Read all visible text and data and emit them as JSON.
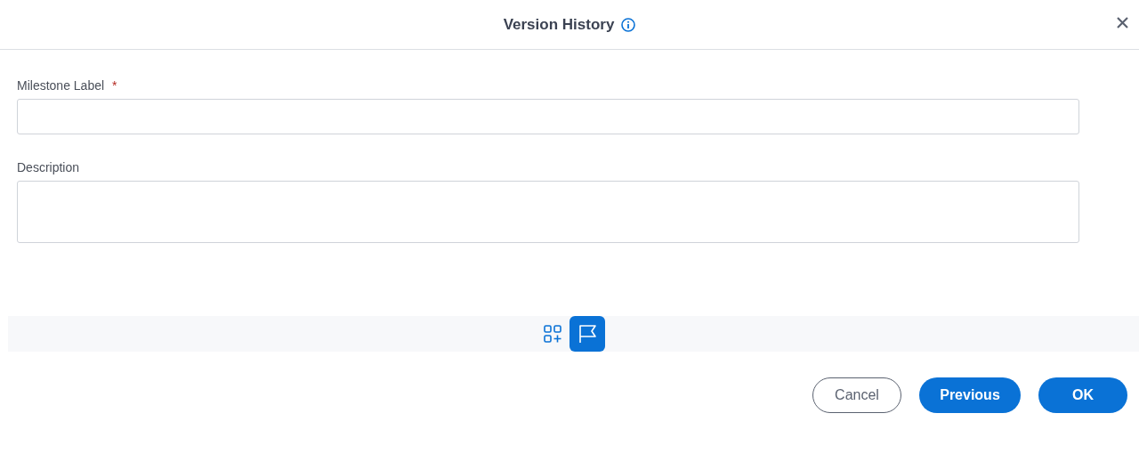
{
  "window": {
    "title": "Version History"
  },
  "fields": [
    {
      "label": "Milestone Label",
      "required_mark": "*",
      "kind": "input"
    },
    {
      "label": "Description",
      "kind": "textarea"
    }
  ],
  "toolbar": [
    {
      "kind": "add-widget",
      "selected": false
    },
    {
      "kind": "flag",
      "selected": true
    }
  ],
  "buttons": [
    {
      "label": "Cancel",
      "kind": "secondary"
    },
    {
      "label": "Previous",
      "kind": "primary"
    },
    {
      "label": "OK",
      "kind": "primary"
    }
  ]
}
